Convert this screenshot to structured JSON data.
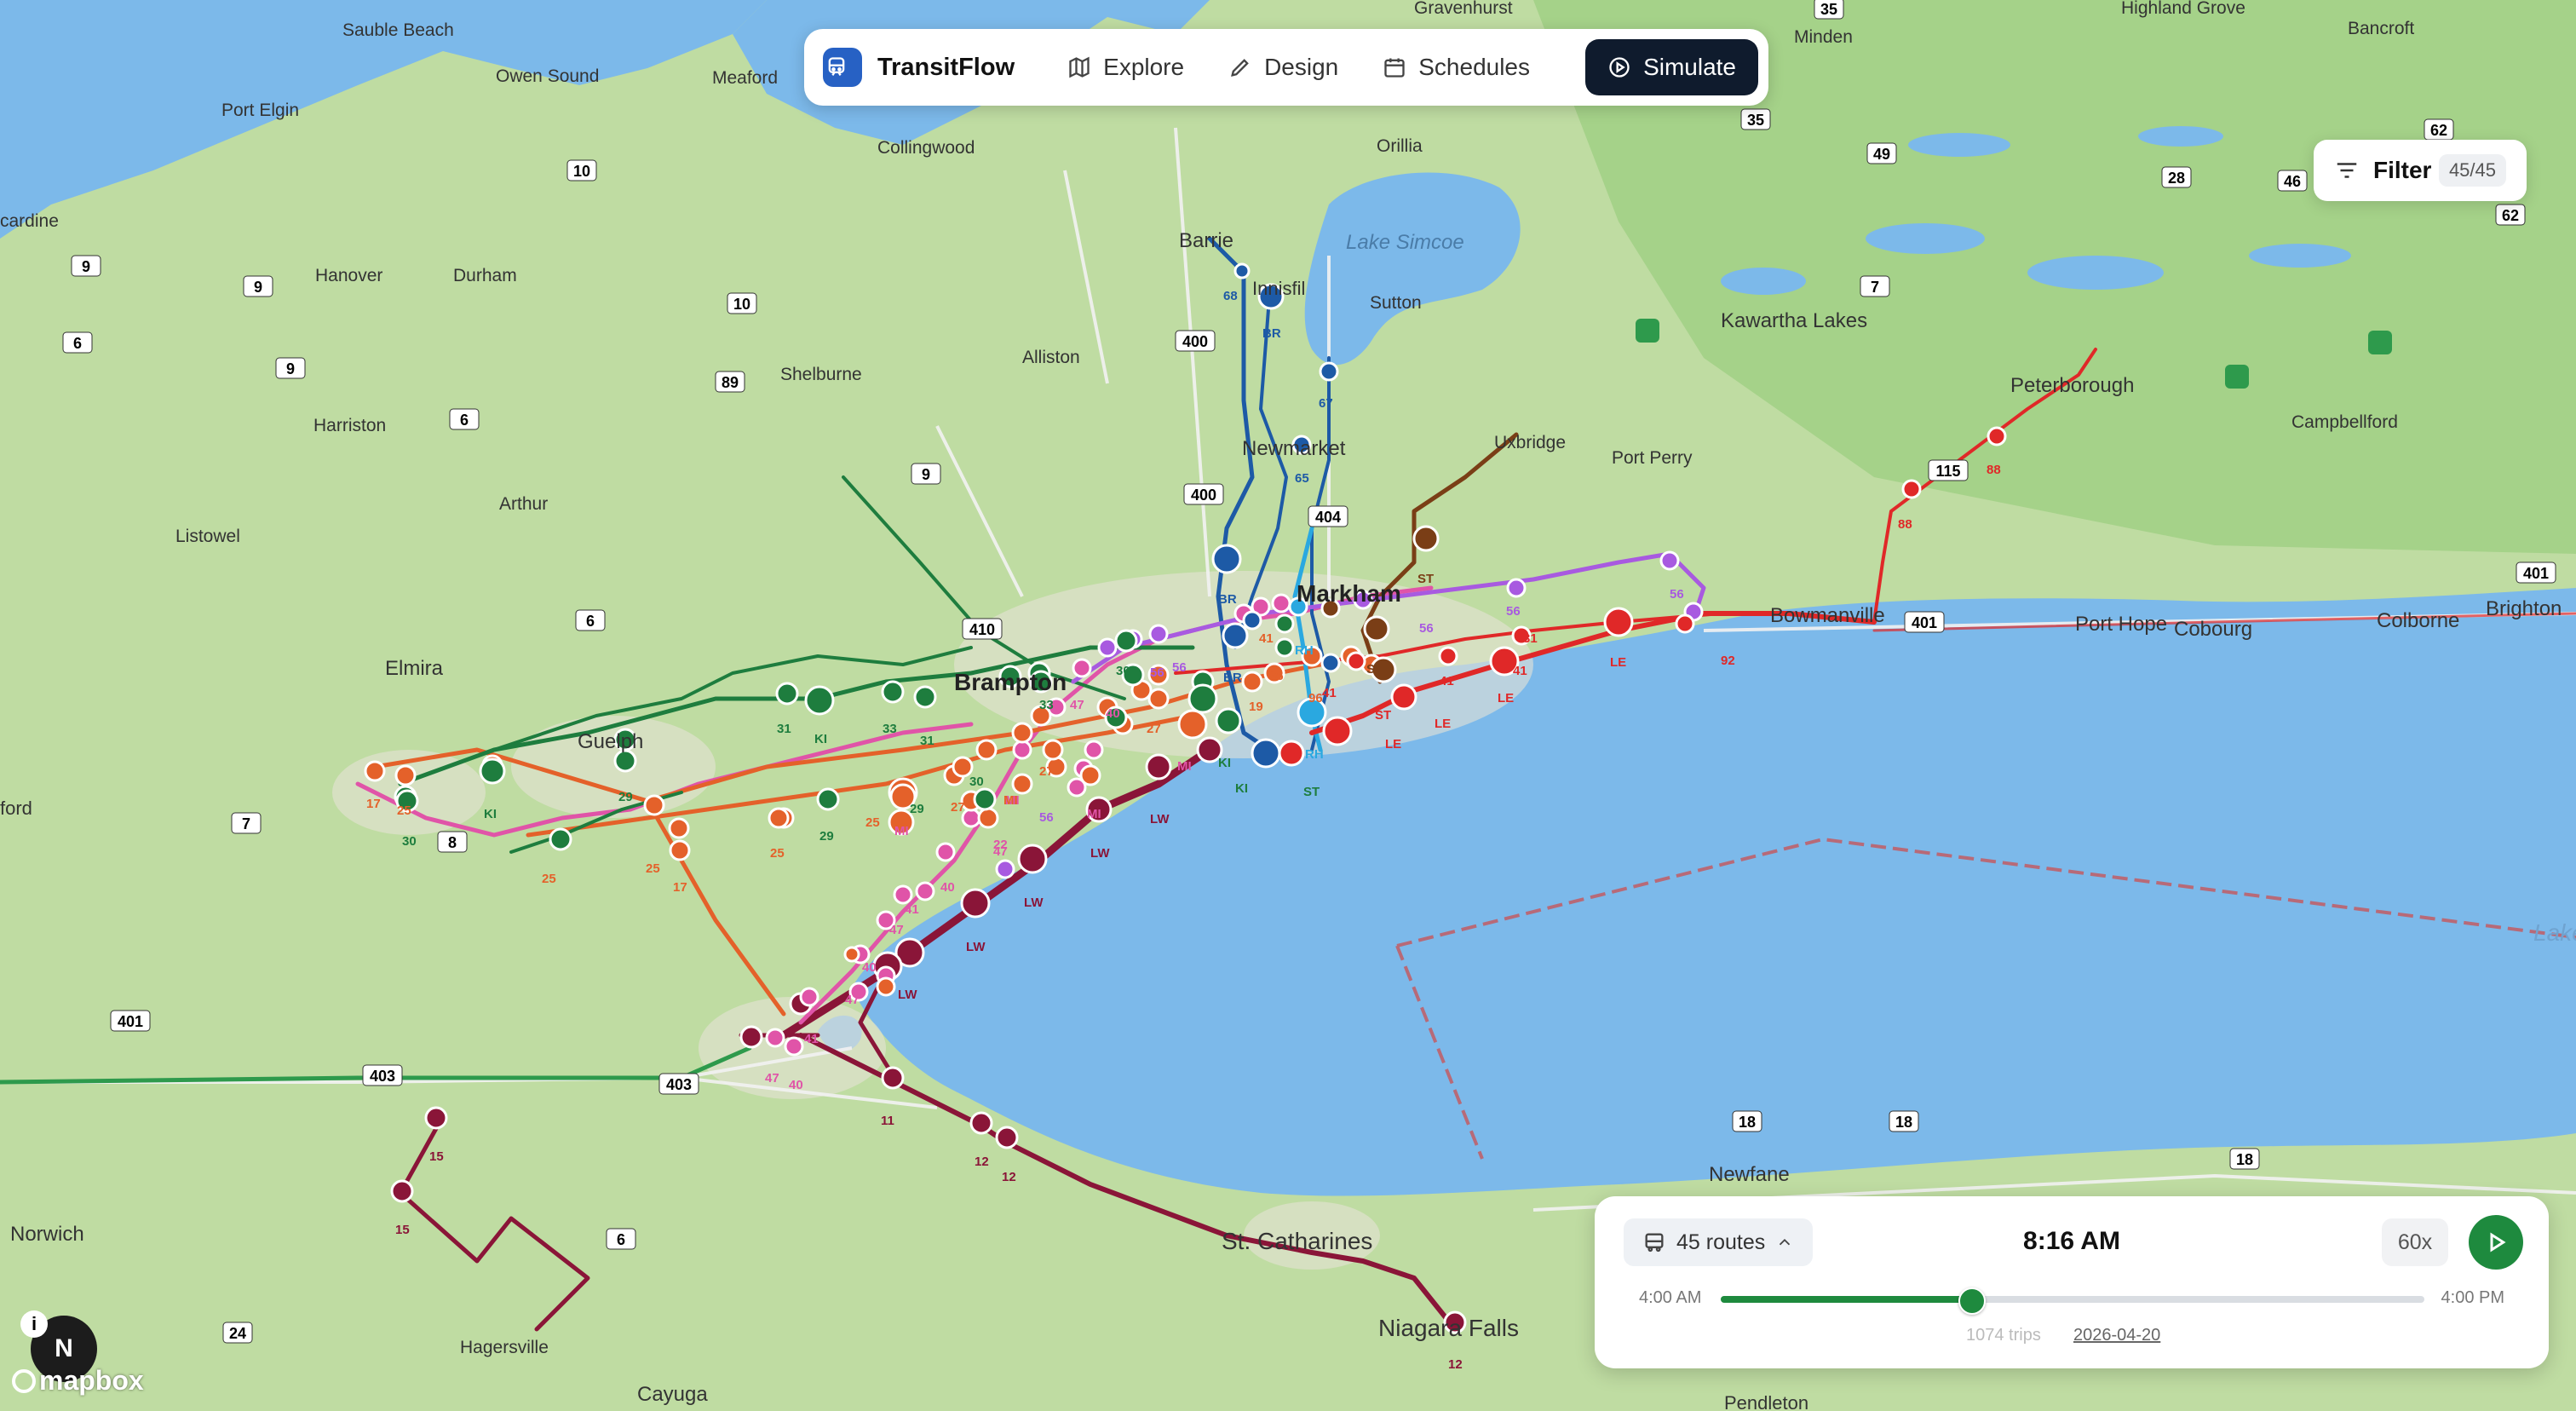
{
  "nav": {
    "brand": "TransitFlow",
    "items": [
      {
        "label": "Explore",
        "icon": "map-icon"
      },
      {
        "label": "Design",
        "icon": "pencil-icon"
      },
      {
        "label": "Schedules",
        "icon": "calendar-icon"
      },
      {
        "label": "Simulate",
        "icon": "play-circle-icon",
        "active": true
      }
    ]
  },
  "filter": {
    "label": "Filter",
    "count": "45/45"
  },
  "sim": {
    "routes_label": "45 routes",
    "time": "8:16 AM",
    "speed": "60x",
    "start_time": "4:00 AM",
    "end_time": "4:00 PM",
    "progress": 0.355,
    "trips": "1074 trips",
    "date": "2026-04-20"
  },
  "map": {
    "compass": "N",
    "attribution": "mapbox",
    "water_color": "#7cb9ea",
    "land_color": "#bcdca0",
    "places": [
      "Sauble Beach",
      "Owen Sound",
      "Meaford",
      "Port Elgin",
      "Collingwood",
      "Orillia",
      "Gravenhurst",
      "Minden",
      "Highland Grove",
      "Bancroft",
      "Barrie",
      "Innisfil",
      "Lake Simcoe",
      "Sutton",
      "Kawartha Lakes",
      "Peterborough",
      "Campbellford",
      "Hanover",
      "Durham",
      "Alliston",
      "Shelburne",
      "Harriston",
      "Newmarket",
      "Uxbridge",
      "Port Perry",
      "Arthur",
      "Listowel",
      "Markham",
      "Bowmanville",
      "Port Hope",
      "Cobourg",
      "Colborne",
      "Brighton",
      "Elmira",
      "Brampton",
      "Guelph",
      "Lake Ontario",
      "Newfane",
      "Norwich",
      "St. Catharines",
      "Niagara Falls",
      "Hagersville",
      "Cayuga",
      "Pendleton",
      "Stratford",
      "Kincardine"
    ],
    "highways": [
      "35",
      "35",
      "62",
      "10",
      "49",
      "28",
      "46",
      "62",
      "9",
      "9",
      "10",
      "7",
      "6",
      "9",
      "400",
      "89",
      "6",
      "7",
      "7",
      "115",
      "88",
      "400",
      "404",
      "410",
      "401",
      "401",
      "401",
      "9",
      "6",
      "7",
      "8",
      "401",
      "403",
      "403",
      "6",
      "24",
      "18",
      "18",
      "18"
    ]
  }
}
